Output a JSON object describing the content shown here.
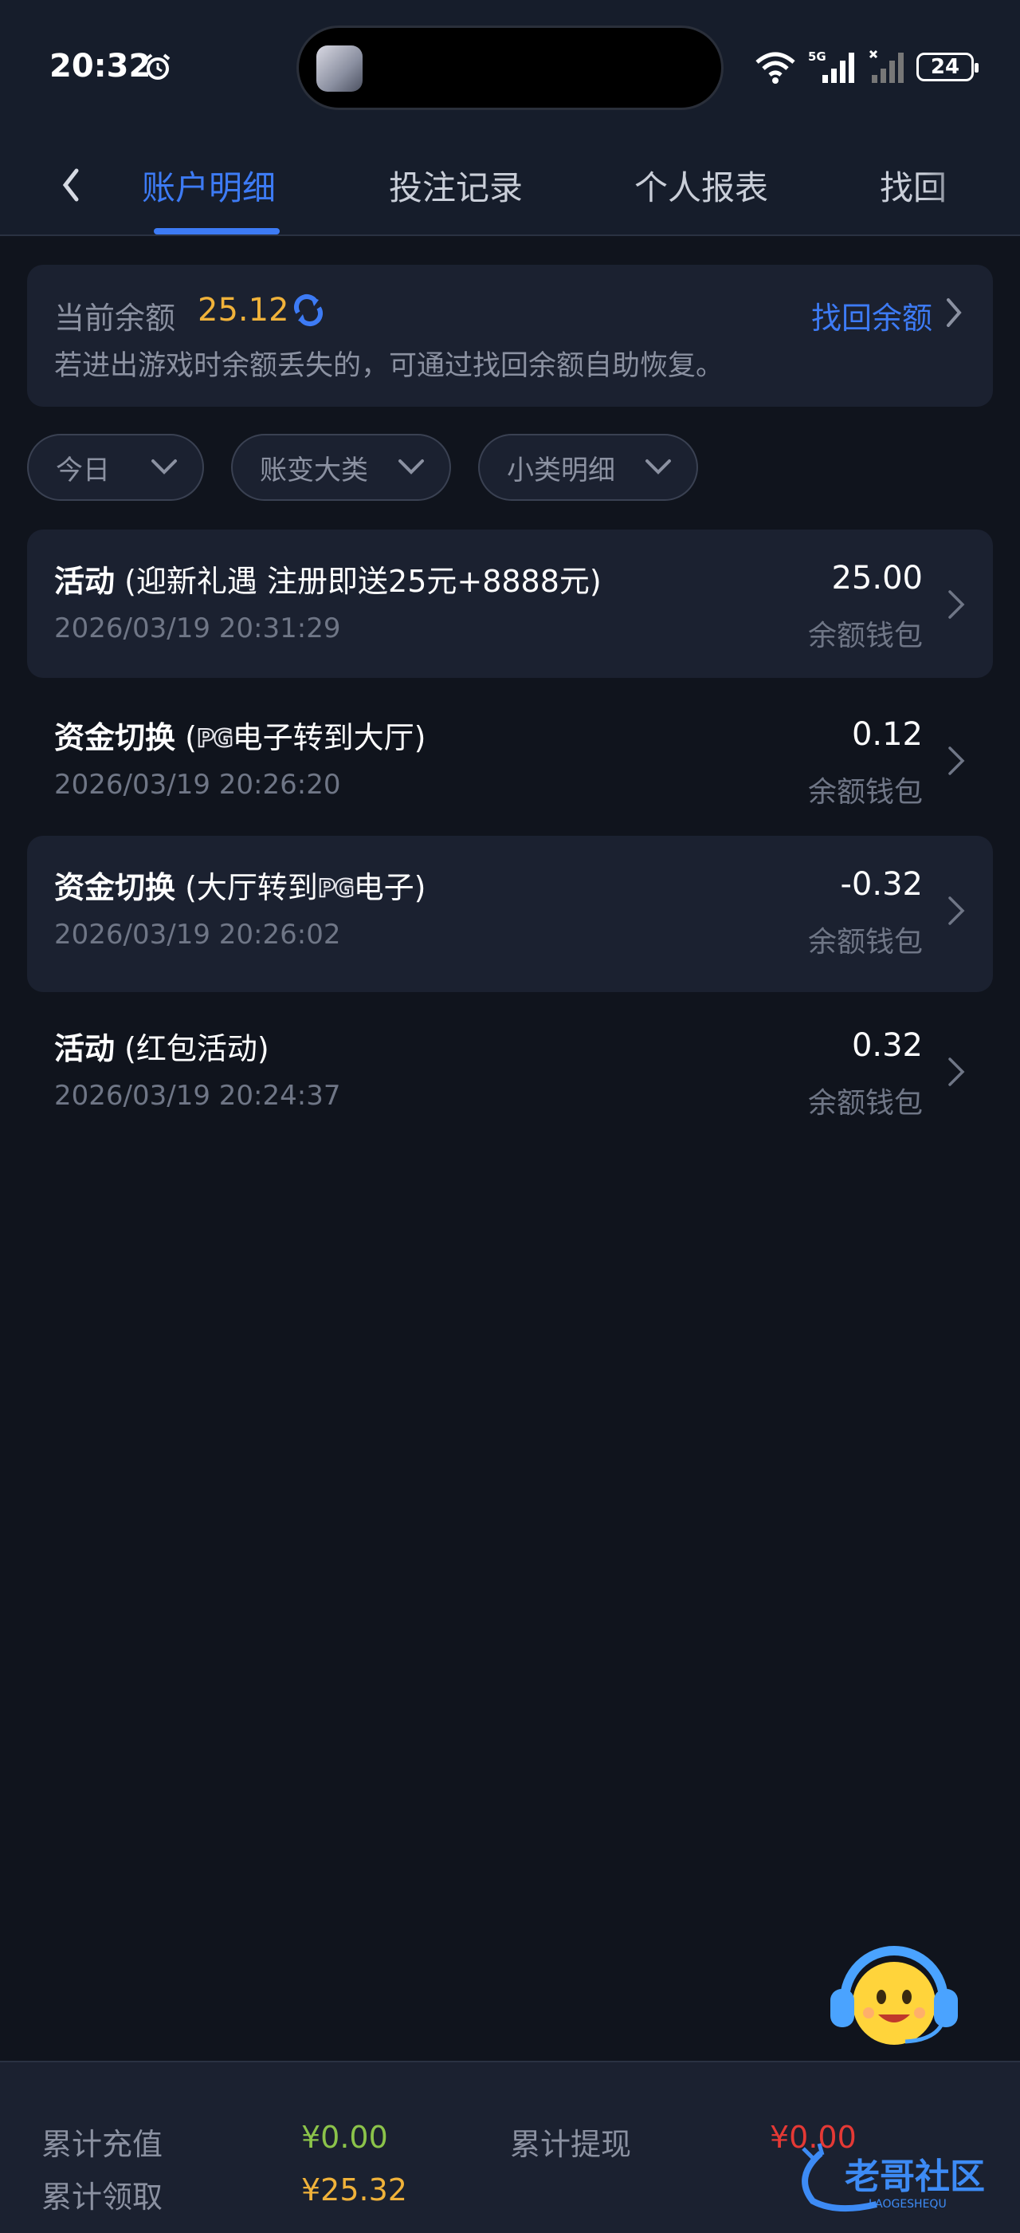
{
  "status_bar": {
    "time": "20:32",
    "battery": "24",
    "network": "5G"
  },
  "nav": {
    "tabs": [
      {
        "label": "账户明细"
      },
      {
        "label": "投注记录"
      },
      {
        "label": "个人报表"
      },
      {
        "label": "找回"
      }
    ],
    "active_tab": 0
  },
  "balance": {
    "label": "当前余额",
    "value": "25.12",
    "recover_label": "找回余额",
    "hint": "若进出游戏时余额丢失的，可通过找回余额自助恢复。"
  },
  "filters": [
    {
      "label": "今日"
    },
    {
      "label": "账变大类"
    },
    {
      "label": "小类明细"
    }
  ],
  "records": [
    {
      "category": "活动",
      "detail_prefix": "(迎新礼遇 注册即送25元+8888元)",
      "pg_logo": "",
      "detail_suffix": "",
      "time": "2026/03/19 20:31:29",
      "amount": "25.00",
      "wallet": "余额钱包"
    },
    {
      "category": "资金切换",
      "detail_prefix": "(",
      "pg_logo": "PG",
      "detail_suffix": "电子转到大厅)",
      "time": "2026/03/19 20:26:20",
      "amount": "0.12",
      "wallet": "余额钱包"
    },
    {
      "category": "资金切换",
      "detail_prefix": "(大厅转到",
      "pg_logo": "PG",
      "detail_suffix": "电子)",
      "time": "2026/03/19 20:26:02",
      "amount": "-0.32",
      "wallet": "余额钱包"
    },
    {
      "category": "活动",
      "detail_prefix": "(红包活动)",
      "pg_logo": "",
      "detail_suffix": "",
      "time": "2026/03/19 20:24:37",
      "amount": "0.32",
      "wallet": "余额钱包"
    }
  ],
  "footer": {
    "deposit_label": "累计充值",
    "deposit_value": "¥0.00",
    "withdraw_label": "累计提现",
    "withdraw_value": "¥0.00",
    "claim_label": "累计领取",
    "claim_value": "¥25.32"
  },
  "watermark": {
    "text": "老哥社区",
    "subtext": "LAOGESHEQU"
  },
  "colors": {
    "accent": "#3d7bf5",
    "balance": "#f0b23a",
    "deposit": "#8bc34a",
    "withdraw": "#e53935",
    "claim": "#f0b23a"
  }
}
